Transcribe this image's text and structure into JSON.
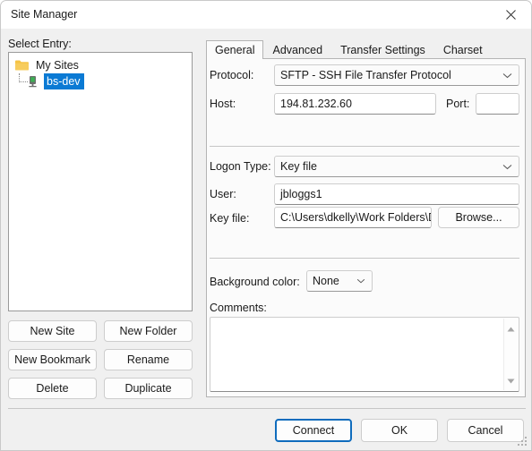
{
  "window": {
    "title": "Site Manager",
    "close_icon": "close-icon"
  },
  "left_pane": {
    "select_entry_label": "Select Entry:",
    "tree": [
      {
        "label": "My Sites",
        "icon": "folder-icon",
        "selected": false
      },
      {
        "label": "bs-dev",
        "icon": "server-icon",
        "selected": true
      }
    ],
    "buttons": [
      "New Site",
      "New Folder",
      "New Bookmark",
      "Rename",
      "Delete",
      "Duplicate"
    ]
  },
  "right_pane": {
    "tabs": [
      {
        "label": "General",
        "active": true
      },
      {
        "label": "Advanced",
        "active": false
      },
      {
        "label": "Transfer Settings",
        "active": false
      },
      {
        "label": "Charset",
        "active": false
      }
    ],
    "general": {
      "protocol_label": "Protocol:",
      "protocol_value": "SFTP - SSH File Transfer Protocol",
      "host_label": "Host:",
      "host_value": "194.81.232.60",
      "port_label": "Port:",
      "port_value": "",
      "logon_type_label": "Logon Type:",
      "logon_type_value": "Key file",
      "user_label": "User:",
      "user_value": "jbloggs1",
      "key_file_label": "Key file:",
      "key_file_value": "C:\\Users\\dkelly\\Work Folders\\D",
      "browse_label": "Browse...",
      "background_color_label": "Background color:",
      "background_color_value": "None",
      "comments_label": "Comments:",
      "comments_value": ""
    }
  },
  "footer": {
    "connect_label": "Connect",
    "ok_label": "OK",
    "cancel_label": "Cancel"
  },
  "colors": {
    "selection_blue": "#0b7ad4",
    "default_button_border": "#0f6cbd",
    "folder_yellow": "#f5c344",
    "server_green": "#3cb054"
  }
}
